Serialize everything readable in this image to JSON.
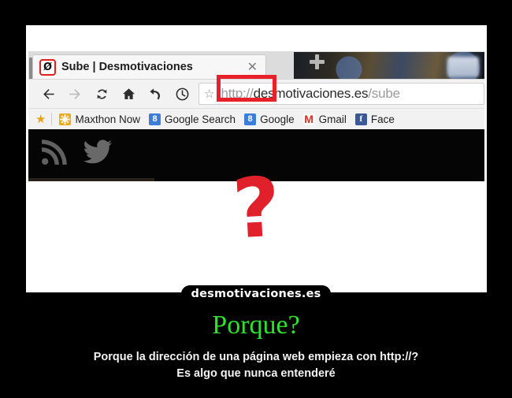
{
  "poster": {
    "title": "Porque?",
    "subtitle_line1": "Porque la dirección de una página web empieza con http://?",
    "subtitle_line2": "Es algo que nunca entenderé",
    "watermark": "desmotivaciones.es",
    "title_color": "#2ee22e",
    "background_color": "#000000",
    "frame_color": "#ffffff"
  },
  "browser": {
    "tab": {
      "title": "Sube | Desmotivaciones",
      "favicon_glyph": "Ø",
      "favicon_color": "#e02020",
      "close_label": "✕"
    },
    "newtab_label": "+",
    "toolbar": {
      "back_label": "←",
      "forward_label": "→",
      "reload_label": "↻",
      "home_label": "⌂",
      "undo_label": "↺",
      "history_label": "🕐"
    },
    "omnibox": {
      "star_label": "☆",
      "url_scheme": "http://",
      "url_host": "desmotivaciones.es",
      "url_path": "/sube",
      "highlight_color": "#e8202a"
    },
    "bookmarks": {
      "star_label": "★",
      "items": [
        {
          "label": "Maxthon Now",
          "icon": "maxthon-icon",
          "glyph": "",
          "color": "#f0a81e"
        },
        {
          "label": "Google Search",
          "icon": "google-icon",
          "glyph": "8",
          "color": "#3b7dd8"
        },
        {
          "label": "Google",
          "icon": "google-icon",
          "glyph": "8",
          "color": "#3b7dd8"
        },
        {
          "label": "Gmail",
          "icon": "gmail-icon",
          "glyph": "M",
          "color": "#d93025"
        },
        {
          "label": "Face",
          "icon": "facebook-icon",
          "glyph": "f",
          "color": "#3b5998"
        }
      ]
    },
    "page": {
      "rss_icon": "rss-icon",
      "twitter_icon": "twitter-icon",
      "question_mark": "?",
      "question_color": "#e0202a"
    }
  }
}
